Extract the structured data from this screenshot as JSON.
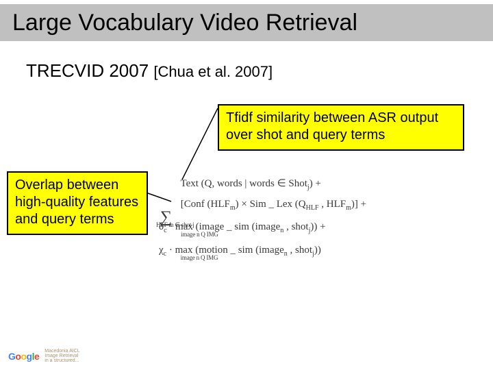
{
  "title": "Large Vocabulary Video Retrieval",
  "subtitle_main": "TRECVID 2007",
  "subtitle_cite": "[Chua et al. 2007]",
  "callout_top": "Tfidf similarity between ASR output over shot and query terms",
  "callout_left": "Overlap between high-quality features and query terms",
  "formula": {
    "line1_a": "Text (Q, words | words ∈ Shot",
    "line1_b": ") +",
    "line2_a": "[Conf (HLF",
    "line2_b": ") × Sim _ Lex (Q",
    "line2_c": " , HLF",
    "line2_d": ")] +",
    "sum_limit": "HLF m ∈ shot j",
    "line3_a": "δ",
    "line3_b": " ·   ",
    "line3_max": "max",
    "line3_limit": "image n Q IMG",
    "line3_c": "  (image _ sim (image",
    "line3_d": " , shot",
    "line3_e": ")) +",
    "line4_a": "χ",
    "line4_b": " ·   ",
    "line4_max": "max",
    "line4_limit": "image n Q IMG",
    "line4_c": "  (motion _ sim (image",
    "line4_d": " , shot",
    "line4_e": "))",
    "sub_j": "j",
    "sub_m": "m",
    "sub_n": "n",
    "sub_c": "c",
    "sub_hlf": "HLF"
  },
  "footer": {
    "google": "Google",
    "sub1": "Macedonia AICL",
    "sub2": "Image Retrieval",
    "sub3": "in a structured..."
  }
}
